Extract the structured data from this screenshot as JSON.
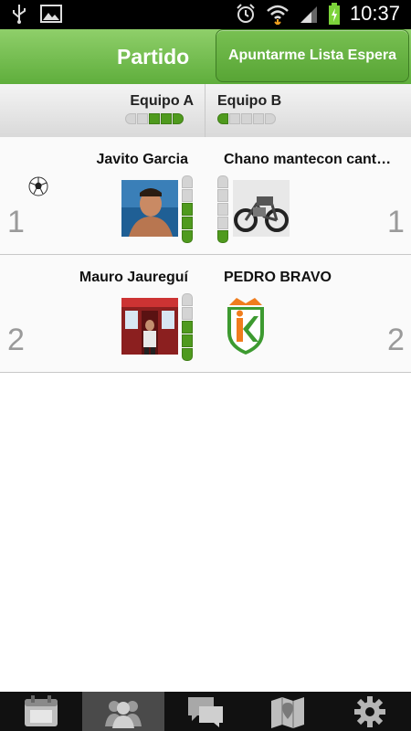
{
  "status_bar": {
    "time": "10:37",
    "icons": [
      "usb-icon",
      "image-icon",
      "alarm-icon",
      "wifi-icon",
      "signal-icon",
      "battery-charging-icon"
    ]
  },
  "action_bar": {
    "title": "Partido",
    "waitlist_button": "Apuntarme Lista Espera",
    "accent_color": "#6bbb45"
  },
  "teams": {
    "team_a": {
      "name": "Equipo A",
      "level": 3,
      "level_max": 5
    },
    "team_b": {
      "name": "Equipo B",
      "level": 1,
      "level_max": 5
    }
  },
  "rows": [
    {
      "position": "1",
      "team_a_player": {
        "name": "Javito Garcia",
        "level": 4,
        "level_max": 6,
        "has_ball": true,
        "avatar": "photo-man-sea"
      },
      "team_b_player": {
        "name": "Chano mantecon cantero",
        "level": 1,
        "level_max": 6,
        "avatar": "photo-motorbike"
      }
    },
    {
      "position": "2",
      "team_a_player": {
        "name": "Mauro Jaureguí",
        "level": 4,
        "level_max": 6,
        "avatar": "photo-man-storefront"
      },
      "team_b_player": {
        "name": "PEDRO BRAVO",
        "avatar": "logo-k-shield"
      }
    }
  ],
  "bottom_nav": [
    {
      "icon": "calendar-icon",
      "active": false
    },
    {
      "icon": "players-icon",
      "active": true
    },
    {
      "icon": "chat-icon",
      "active": false
    },
    {
      "icon": "map-icon",
      "active": false
    },
    {
      "icon": "settings-gear-icon",
      "active": false
    }
  ]
}
